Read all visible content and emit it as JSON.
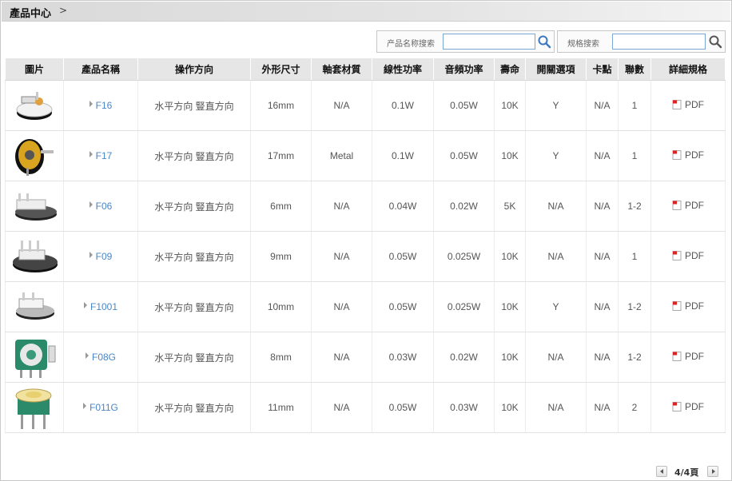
{
  "header": {
    "title": "產品中心",
    "separator": ">"
  },
  "search": {
    "name_label": "产品名称搜索",
    "name_value": "",
    "spec_label": "规格搜索",
    "spec_value": ""
  },
  "columns": [
    "圖片",
    "產品名稱",
    "操作方向",
    "外形尺寸",
    "軸套材質",
    "線性功率",
    "音頻功率",
    "壽命",
    "開關選項",
    "卡點",
    "聯數",
    "詳細規格"
  ],
  "rows": [
    {
      "image": "f16-thumbnail",
      "name": "F16",
      "direction": "水平方向 豎直方向",
      "size": "16mm",
      "material": "N/A",
      "linear": "0.1W",
      "audio": "0.05W",
      "life": "10K",
      "switch": "Y",
      "detent": "N/A",
      "gang": "1",
      "spec": "PDF"
    },
    {
      "image": "f17-thumbnail",
      "name": "F17",
      "direction": "水平方向 豎直方向",
      "size": "17mm",
      "material": "Metal",
      "linear": "0.1W",
      "audio": "0.05W",
      "life": "10K",
      "switch": "Y",
      "detent": "N/A",
      "gang": "1",
      "spec": "PDF"
    },
    {
      "image": "f06-thumbnail",
      "name": "F06",
      "direction": "水平方向 豎直方向",
      "size": "6mm",
      "material": "N/A",
      "linear": "0.04W",
      "audio": "0.02W",
      "life": "5K",
      "switch": "N/A",
      "detent": "N/A",
      "gang": "1-2",
      "spec": "PDF"
    },
    {
      "image": "f09-thumbnail",
      "name": "F09",
      "direction": "水平方向 豎直方向",
      "size": "9mm",
      "material": "N/A",
      "linear": "0.05W",
      "audio": "0.025W",
      "life": "10K",
      "switch": "N/A",
      "detent": "N/A",
      "gang": "1",
      "spec": "PDF"
    },
    {
      "image": "f1001-thumbnail",
      "name": "F1001",
      "direction": "水平方向 豎直方向",
      "size": "10mm",
      "material": "N/A",
      "linear": "0.05W",
      "audio": "0.025W",
      "life": "10K",
      "switch": "Y",
      "detent": "N/A",
      "gang": "1-2",
      "spec": "PDF"
    },
    {
      "image": "f08g-thumbnail",
      "name": "F08G",
      "direction": "水平方向 豎直方向",
      "size": "8mm",
      "material": "N/A",
      "linear": "0.03W",
      "audio": "0.02W",
      "life": "10K",
      "switch": "N/A",
      "detent": "N/A",
      "gang": "1-2",
      "spec": "PDF"
    },
    {
      "image": "f011g-thumbnail",
      "name": "F011G",
      "direction": "水平方向 豎直方向",
      "size": "11mm",
      "material": "N/A",
      "linear": "0.05W",
      "audio": "0.03W",
      "life": "10K",
      "switch": "N/A",
      "detent": "N/A",
      "gang": "2",
      "spec": "PDF"
    }
  ],
  "pager": {
    "text": "4/4頁"
  },
  "colors": {
    "link": "#4a86c6",
    "header_bg": "#e6e6e6",
    "input_border": "#7aa7d6"
  }
}
